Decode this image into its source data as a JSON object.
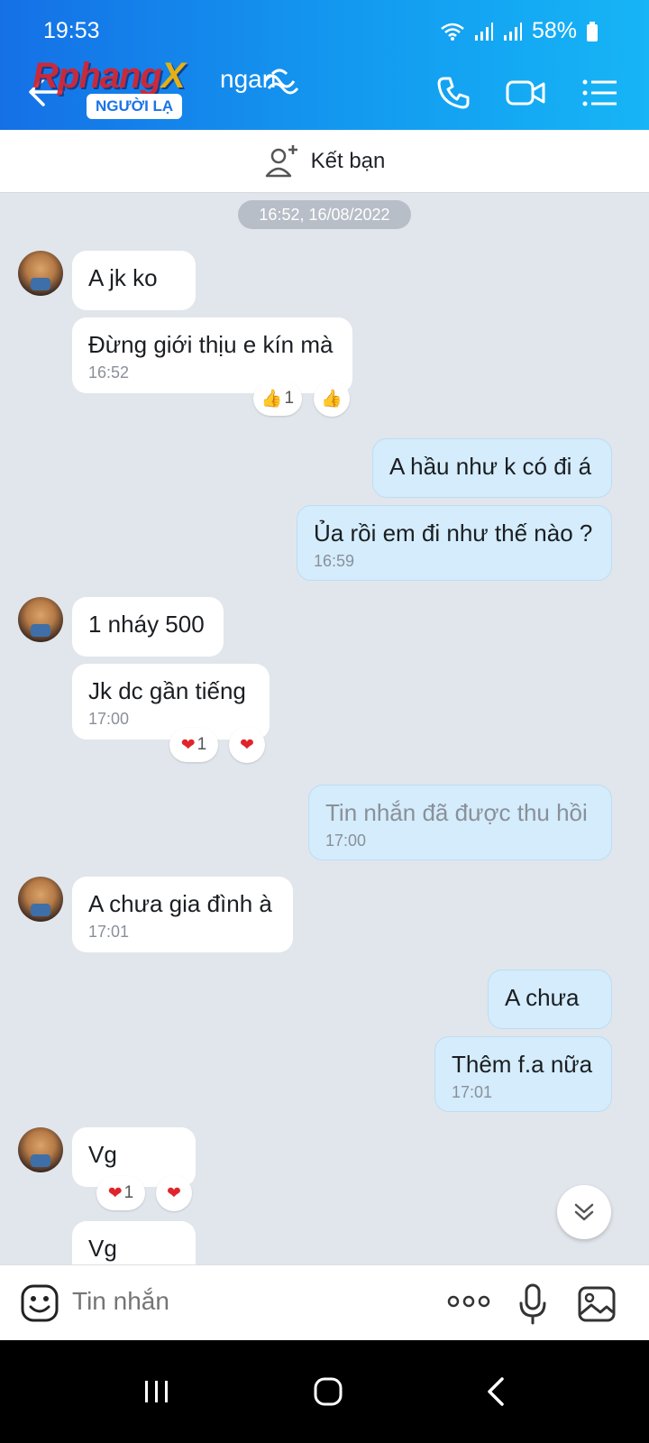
{
  "status_bar": {
    "time": "19:53",
    "battery": "58%"
  },
  "header": {
    "contact_name": "ngan",
    "logo_text_main": "Rphang",
    "logo_text_x": "X",
    "badge": "NGƯỜI LẠ"
  },
  "friend_bar": {
    "label": "Kết bạn"
  },
  "chat": {
    "date": "16:52, 16/08/2022",
    "messages": [
      {
        "text": "A jk ko"
      },
      {
        "text": "Đừng giới thịu e kín mà",
        "time": "16:52",
        "reaction_count": "1"
      },
      {
        "text": "A hầu như k có đi á"
      },
      {
        "text": "Ủa rồi em đi như thế nào ?",
        "time": "16:59"
      },
      {
        "text": "1 nháy 500"
      },
      {
        "text": "Jk dc gần tiếng",
        "time": "17:00",
        "reaction_count": "1"
      },
      {
        "text": "Tin nhắn đã được thu hồi",
        "time": "17:00"
      },
      {
        "text": "A chưa gia đình à",
        "time": "17:01"
      },
      {
        "text": "A chưa"
      },
      {
        "text": "Thêm f.a nữa",
        "time": "17:01"
      },
      {
        "text": "Vg",
        "reaction_count": "1"
      },
      {
        "text": "Vg"
      }
    ]
  },
  "input": {
    "placeholder": "Tin nhắn"
  },
  "colors": {
    "header_start": "#1570e6",
    "header_end": "#16b5f6",
    "out_bubble": "#d4ecfb",
    "in_bubble": "#ffffff"
  }
}
